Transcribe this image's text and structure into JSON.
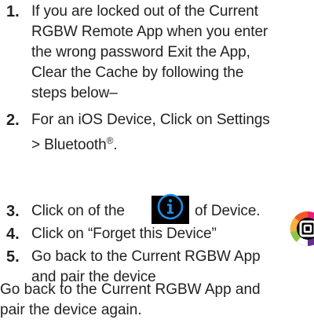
{
  "steps": [
    {
      "num": "1.",
      "text": "If you are locked out of the Current\nRGBW Remote App when you enter\nthe wrong password Exit the App,\nClear the Cache by following the\nsteps below–"
    },
    {
      "num": "2.",
      "text": "For an iOS Device, Click on Settings\n> Bluetooth",
      "reg": "®",
      "text_end": "."
    },
    {
      "num": "3.",
      "text_pre": "Click on of the",
      "text_post": "of Device."
    },
    {
      "num": "4.",
      "text": "Click on “Forget this Device”"
    },
    {
      "num": "5.",
      "text": "Go back to the Current RGBW App\nand pair the device"
    }
  ],
  "final_text": "Go back to the Current RGBW App and\npair the device again.",
  "icons": {
    "info": "info-circle-icon",
    "app": "rgbw-app-icon"
  },
  "colors": {
    "text": "#231f20",
    "info_blue": "#1e8fe8",
    "icon_bg": "#000000"
  }
}
